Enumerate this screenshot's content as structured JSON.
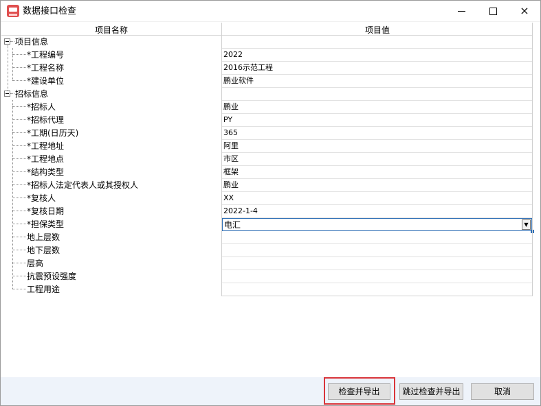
{
  "window": {
    "title": "数据接口检查",
    "minimize_label": "—",
    "maximize_label": "□",
    "close_label": "×"
  },
  "grid": {
    "header_name": "项目名称",
    "header_value": "项目值",
    "rows": [
      {
        "kind": "group",
        "label": "项目信息",
        "value": ""
      },
      {
        "kind": "child",
        "label": "*工程编号",
        "value": "2022"
      },
      {
        "kind": "child",
        "label": "*工程名称",
        "value": "2016示范工程"
      },
      {
        "kind": "child",
        "label": "*建设单位",
        "value": "鹏业软件"
      },
      {
        "kind": "group",
        "label": "招标信息",
        "value": ""
      },
      {
        "kind": "child",
        "label": "*招标人",
        "value": "鹏业"
      },
      {
        "kind": "child",
        "label": "*招标代理",
        "value": "PY"
      },
      {
        "kind": "child",
        "label": "*工期(日历天)",
        "value": "365"
      },
      {
        "kind": "child",
        "label": "*工程地址",
        "value": "阿里"
      },
      {
        "kind": "child",
        "label": "*工程地点",
        "value": "市区"
      },
      {
        "kind": "child",
        "label": "*结构类型",
        "value": "框架"
      },
      {
        "kind": "child",
        "label": "*招标人法定代表人或其授权人",
        "value": "鹏业"
      },
      {
        "kind": "child",
        "label": "*复核人",
        "value": "XX"
      },
      {
        "kind": "child",
        "label": "*复核日期",
        "value": "2022-1-4"
      },
      {
        "kind": "child",
        "label": "*担保类型",
        "value": "电汇",
        "selected": true
      },
      {
        "kind": "child",
        "label": "地上层数",
        "value": ""
      },
      {
        "kind": "child",
        "label": "地下层数",
        "value": ""
      },
      {
        "kind": "child",
        "label": "层高",
        "value": ""
      },
      {
        "kind": "child",
        "label": "抗震预设强度",
        "value": ""
      },
      {
        "kind": "child",
        "label": "工程用途",
        "value": ""
      }
    ]
  },
  "buttons": {
    "check_export": "检查并导出",
    "skip_export": "跳过检查并导出",
    "cancel": "取消"
  },
  "colors": {
    "highlight": "#d9343a",
    "selection": "#2f6fb5",
    "footer_bg": "#eef3fa",
    "app_icon": "#e04f4f"
  }
}
